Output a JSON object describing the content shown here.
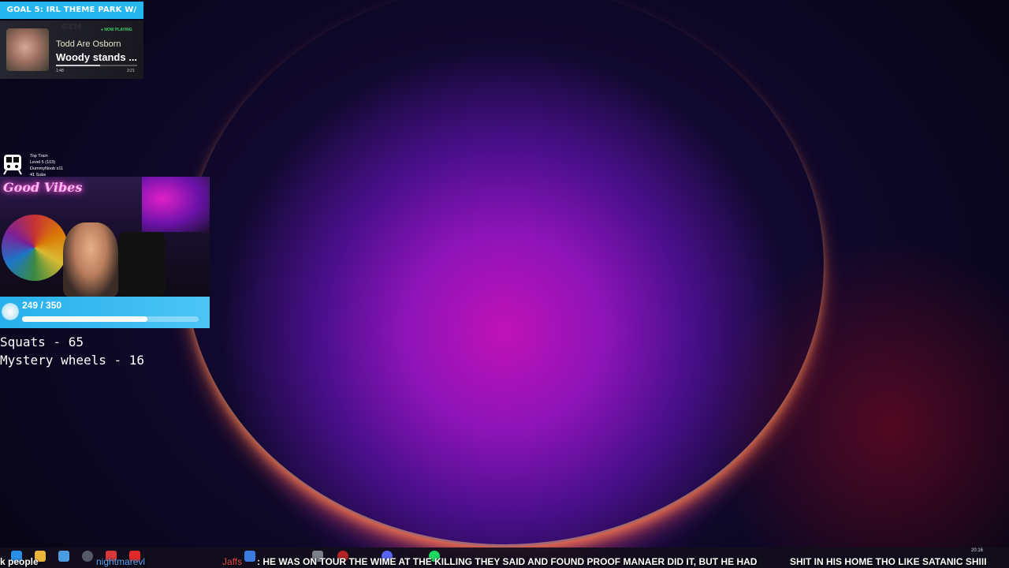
{
  "goal_banner": {
    "text": "GOAL 5: IRL THEME PARK W/ GEM"
  },
  "now_playing": {
    "status": "● NOW PLAYING",
    "artist": "Todd Are Osborn",
    "title": "Woody stands ...",
    "elapsed": "1:48",
    "duration": "3:21",
    "progress_fraction": 0.54
  },
  "train": {
    "icon": "train-icon",
    "lines": [
      "Top Train",
      "Level 5 (103)",
      "DummyNoob x11",
      "41 Subs"
    ]
  },
  "webcam": {
    "neon_sign": "Good Vibes"
  },
  "sub_goal": {
    "text": "249 / 350",
    "current": 249,
    "target": 350
  },
  "counters": {
    "squats": "Squats - 65",
    "mystery_wheels": "Mystery wheels - 16"
  },
  "ticker": {
    "prev_fragment": "k people",
    "user": "nightmarevl",
    "user2": "Jaffs",
    "message": ": HE WAS ON TOUR THE WIME AT THE KILLING THEY SAID AND FOUND PROOF MANAER DID IT, BUT HE HAD",
    "message2": "SHIT IN HIS HOME THO LIKE SATANIC SHIII"
  },
  "taskbar": {
    "time": "20:16",
    "icons": [
      "windows-start-icon",
      "file-explorer-icon",
      "browser-icon",
      "obs-icon",
      "maps-icon",
      "youtube-icon",
      "app-icon",
      "steam-icon",
      "settings-icon",
      "discord-icon",
      "spotify-icon"
    ]
  },
  "colors": {
    "accent_blue": "#25b5ef",
    "now_playing_green": "#3fd26b",
    "ticker_user": "#5aa9ff"
  }
}
